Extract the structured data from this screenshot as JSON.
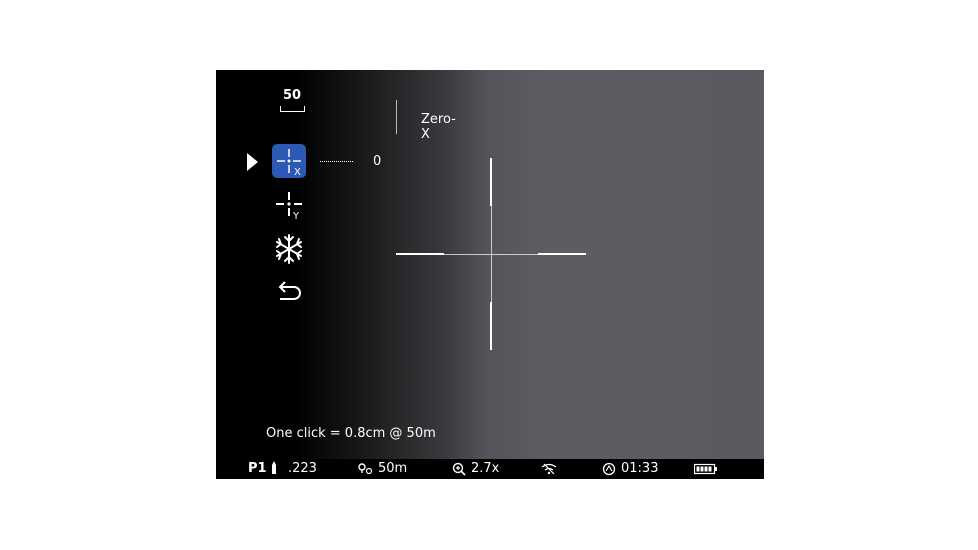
{
  "header": {
    "distance": "50",
    "profile_name": "Zero-X"
  },
  "menu": {
    "items": [
      {
        "icon": "zero-x-icon",
        "selected": true,
        "value": "0"
      },
      {
        "icon": "zero-y-icon",
        "selected": false
      },
      {
        "icon": "freeze-icon",
        "selected": false
      },
      {
        "icon": "back-icon",
        "selected": false
      }
    ]
  },
  "hint": "One click = 0.8cm @ 50m",
  "status": {
    "profile": "P1",
    "caliber": ".223",
    "distance": "50m",
    "zoom": "2.7x",
    "time": "01:33"
  },
  "colors": {
    "selected": "#2b59b4",
    "status_bar": "#000000",
    "text": "#ffffff"
  }
}
